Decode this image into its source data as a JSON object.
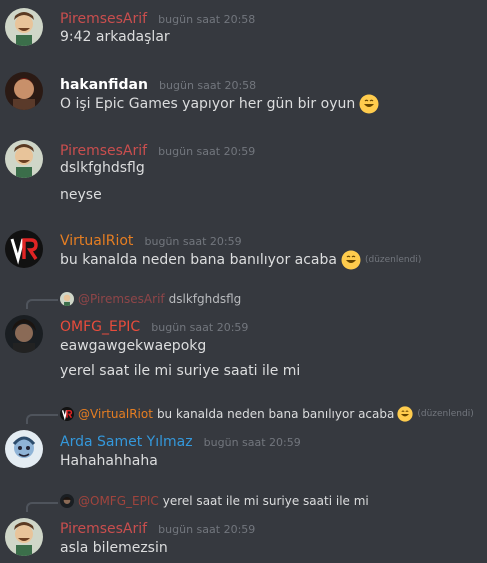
{
  "colors": {
    "background": "#36393f",
    "pirem": "#c94e4e",
    "hakan": "#ffffff",
    "virtual": "#e67e22",
    "omfg": "#e74c3c",
    "arda": "#3498db",
    "timestamp": "#72767d"
  },
  "messages": [
    {
      "user": "PiremsesArif",
      "time": "bugün saat 20:58",
      "lines": [
        "9:42 arkadaşlar"
      ]
    },
    {
      "user": "hakanfidan",
      "time": "bugün saat 20:58",
      "lines": [
        "O işi Epic Games yapıyor her gün bir oyun"
      ],
      "emoji": "grinning-emoji"
    },
    {
      "user": "PiremsesArif",
      "time": "bugün saat 20:59",
      "lines": [
        "dslkfghdsflg",
        "neyse"
      ]
    },
    {
      "user": "VirtualRiot",
      "time": "bugün saat 20:59",
      "lines": [
        "bu kanalda neden bana banılıyor acaba"
      ],
      "emoji": "grinning-emoji",
      "edited": "(düzenlendi)"
    },
    {
      "reply_to": {
        "user": "@PiremsesArif",
        "text": "dslkfghdsflg"
      },
      "user": "OMFG_EPIC",
      "time": "bugün saat 20:59",
      "lines": [
        "eawgawgekwaepokg",
        "yerel saat ile mi suriye saati ile mi"
      ]
    },
    {
      "reply_to": {
        "user": "@VirtualRiot",
        "text": "bu kanalda neden bana banılıyor acaba",
        "edited": "(düzenlendi)"
      },
      "user": "Arda Samet Yılmaz",
      "time": "bugün saat 20:59",
      "lines": [
        "Hahahahhaha"
      ]
    },
    {
      "reply_to": {
        "user": "@OMFG_EPIC",
        "text": "yerel saat ile mi suriye saati ile mi"
      },
      "user": "PiremsesArif",
      "time": "bugün saat 20:59",
      "lines": [
        "asla bilemezsin"
      ]
    }
  ]
}
